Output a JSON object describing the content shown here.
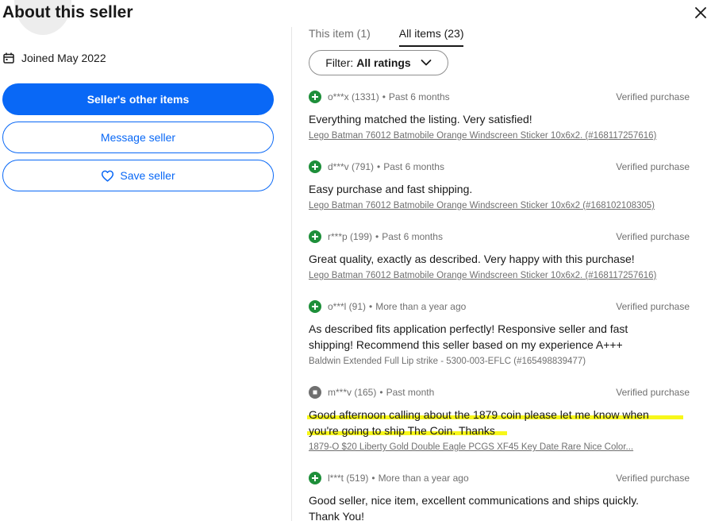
{
  "header": {
    "title": "About this seller"
  },
  "seller": {
    "joined": "Joined May 2022",
    "other_items_label": "Seller's other items",
    "message_label": "Message seller",
    "save_label": "Save seller"
  },
  "tabs": [
    {
      "label": "This item (1)",
      "active": false
    },
    {
      "label": "All items (23)",
      "active": true
    }
  ],
  "filter": {
    "prefix": "Filter:",
    "value": "All ratings"
  },
  "reviews": [
    {
      "rating": "positive",
      "user": "o***x (1331)",
      "time": "Past 6 months",
      "verified": "Verified purchase",
      "text": "Everything matched the listing. Very satisfied!",
      "item": "Lego Batman 76012 Batmobile Orange Windscreen Sticker 10x6x2. (#168117257616)"
    },
    {
      "rating": "positive",
      "user": "d***v (791)",
      "time": "Past 6 months",
      "verified": "Verified purchase",
      "text": "Easy purchase and fast shipping.",
      "item": "Lego Batman 76012 Batmobile Orange Windscreen Sticker 10x6x2 (#168102108305)"
    },
    {
      "rating": "positive",
      "user": "r***p (199)",
      "time": "Past 6 months",
      "verified": "Verified purchase",
      "text": "Great quality, exactly as described. Very happy with this purchase!",
      "item": "Lego Batman 76012 Batmobile Orange Windscreen Sticker 10x6x2. (#168117257616)"
    },
    {
      "rating": "positive",
      "user": "o***l (91)",
      "time": "More than a year ago",
      "verified": "Verified purchase",
      "text": "As described fits application perfectly! Responsive seller and fast shipping! Recommend this seller based on my experience A+++",
      "item": "Baldwin Extended Full Lip strike - 5300-003-EFLC (#165498839477)"
    },
    {
      "rating": "neutral",
      "user": "m***v (165)",
      "time": "Past month",
      "verified": "Verified purchase",
      "text": "Good afternoon calling about the 1879 coin please let me know when you're going to ship The Coin. Thanks",
      "item": "1879-O $20 Liberty Gold Double Eagle PCGS XF45 Key Date Rare Nice Color..."
    },
    {
      "rating": "positive",
      "user": "l***t (519)",
      "time": "More than a year ago",
      "verified": "Verified purchase",
      "text": "Good seller, nice item, excellent communications and ships quickly. Thank You!",
      "item": ""
    }
  ],
  "colors": {
    "accent": "#0968f6",
    "positive": "#1e8f3a",
    "neutral": "#707070",
    "highlight": "#f7f71a"
  }
}
